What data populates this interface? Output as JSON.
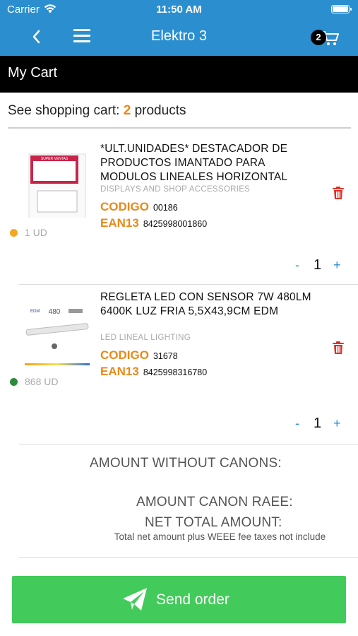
{
  "status_bar": {
    "carrier": "Carrier",
    "time": "11:50 AM"
  },
  "nav": {
    "title": "Elektro 3",
    "cart_count": "2"
  },
  "section": {
    "title": "My Cart"
  },
  "summary": {
    "prefix": "See shopping cart:",
    "count": "2",
    "suffix": "products"
  },
  "items": [
    {
      "title": "*ULT.UNIDADES*  DESTACADOR DE PRODUCTOS IMANTADO PARA MODULOS LINEALES HORIZONTAL",
      "category": "DISPLAYS AND SHOP ACCESSORIES",
      "codigo_label": "CODIGO",
      "codigo": "00186",
      "ean_label": "EAN13",
      "ean": "8425998001860",
      "stock": "1 UD",
      "stock_color": "#f5a623",
      "quantity": "1",
      "thumb_caption": "SUPER VENTAS"
    },
    {
      "title": "REGLETA LED CON SENSOR 7W 480LM 6400K LUZ FRIA 5,5X43,9CM EDM",
      "category": "LED LINEAL LIGHTING",
      "codigo_label": "CODIGO",
      "codigo": "31678",
      "ean_label": "EAN13",
      "ean": "8425998316780",
      "stock": "868 UD",
      "stock_color": "#2e8b3a",
      "quantity": "1",
      "thumb_caption": "480"
    }
  ],
  "qty_controls": {
    "minus": "-",
    "plus": "+"
  },
  "totals": {
    "without_canons": "AMOUNT WITHOUT CANONS:",
    "canon_raee": "AMOUNT CANON RAEE:",
    "net_total": "NET TOTAL AMOUNT:",
    "fee_note": "Total net amount plus WEEE fee taxes not include"
  },
  "send_button": {
    "label": "Send order"
  },
  "colors": {
    "brand_blue": "#2b8fcf",
    "accent_orange": "#e8891a",
    "send_green": "#42cb5a",
    "trash_red": "#d9342b"
  },
  "icons": [
    "wifi-icon",
    "battery-icon",
    "back-chevron-icon",
    "menu-icon",
    "cart-icon",
    "trash-icon",
    "paper-plane-icon"
  ]
}
